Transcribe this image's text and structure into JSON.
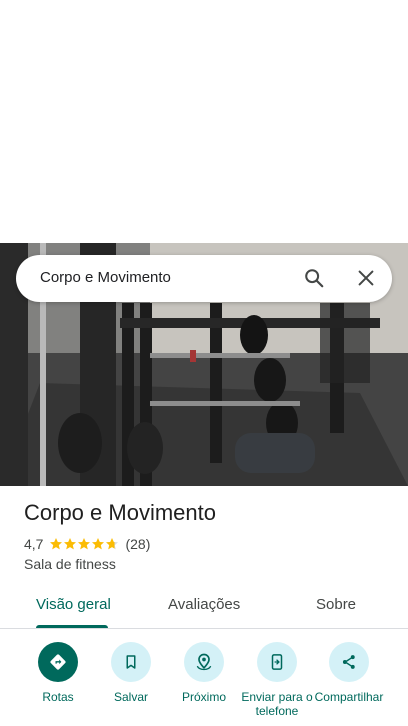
{
  "search": {
    "query": "Corpo e Movimento"
  },
  "place": {
    "name": "Corpo e Movimento",
    "rating": "4,7",
    "stars": 4.7,
    "reviews_count": "(28)",
    "category": "Sala de fitness"
  },
  "tabs": [
    {
      "label": "Visão geral",
      "active": true
    },
    {
      "label": "Avaliações",
      "active": false
    },
    {
      "label": "Sobre",
      "active": false
    }
  ],
  "actions": [
    {
      "label": "Rotas",
      "icon": "directions-icon"
    },
    {
      "label": "Salvar",
      "icon": "bookmark-icon"
    },
    {
      "label": "Próximo",
      "icon": "nearby-icon"
    },
    {
      "label": "Enviar para o telefone",
      "icon": "send-to-phone-icon"
    },
    {
      "label": "Compartilhar",
      "icon": "share-icon"
    }
  ],
  "colors": {
    "accent": "#00695c",
    "action_bg": "#d4f1f7",
    "star": "#fbbc04"
  }
}
